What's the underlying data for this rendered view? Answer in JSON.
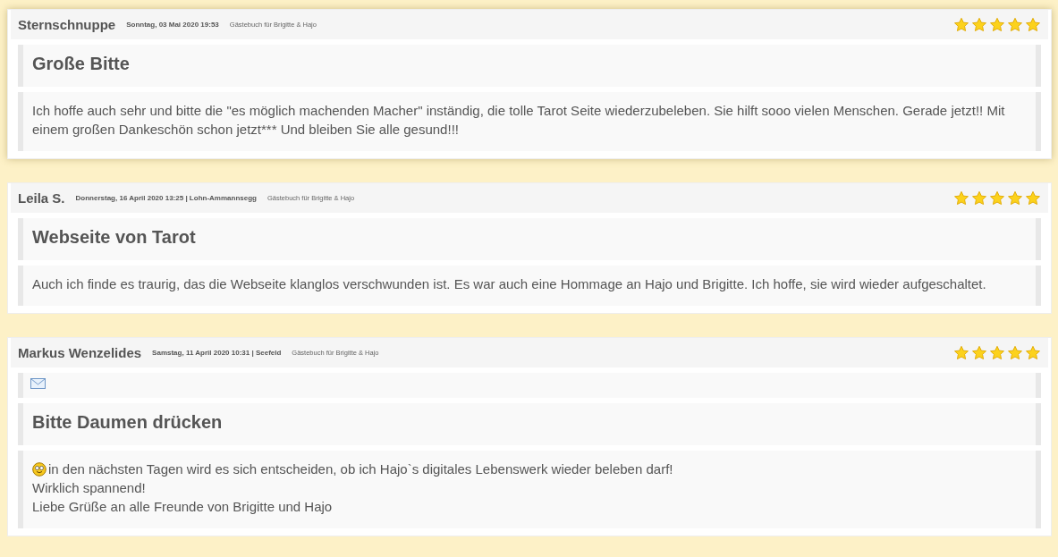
{
  "entries": [
    {
      "author": "Sternschnuppe",
      "date": "Sonntag, 03 Mai 2020 19:53",
      "guestbook": "Gästebuch für Brigitte & Hajo",
      "stars": 5,
      "highlighted": true,
      "email_icon": false,
      "title": "Große Bitte",
      "emoticon": false,
      "lines": [
        "Ich hoffe auch sehr und bitte die \"es möglich machenden Macher\" inständig, die tolle Tarot Seite wiederzubeleben. Sie hilft sooo vielen Menschen. Gerade jetzt!! Mit einem großen Dankeschön schon jetzt*** Und bleiben Sie alle gesund!!!"
      ]
    },
    {
      "author": "Leila S.",
      "date": "Donnerstag, 16 April 2020 13:25 | Lohn-Ammannsegg",
      "guestbook": "Gästebuch für Brigitte & Hajo",
      "stars": 5,
      "highlighted": false,
      "email_icon": false,
      "title": "Webseite von Tarot",
      "emoticon": false,
      "lines": [
        "Auch ich finde es traurig, das die Webseite klanglos verschwunden ist. Es war auch eine Hommage an Hajo und Brigitte. Ich hoffe, sie wird wieder aufgeschaltet."
      ]
    },
    {
      "author": "Markus Wenzelides",
      "date": "Samstag, 11 April 2020 10:31 | Seefeld",
      "guestbook": "Gästebuch für Brigitte & Hajo",
      "stars": 5,
      "highlighted": false,
      "email_icon": true,
      "title": "Bitte Daumen drücken",
      "emoticon": true,
      "lines": [
        "in den nächsten Tagen wird es sich entscheiden, ob ich Hajo`s digitales Lebenswerk wieder beleben darf!",
        "Wirklich spannend!",
        "Liebe Grüße an alle Freunde von Brigitte und Hajo"
      ]
    }
  ]
}
